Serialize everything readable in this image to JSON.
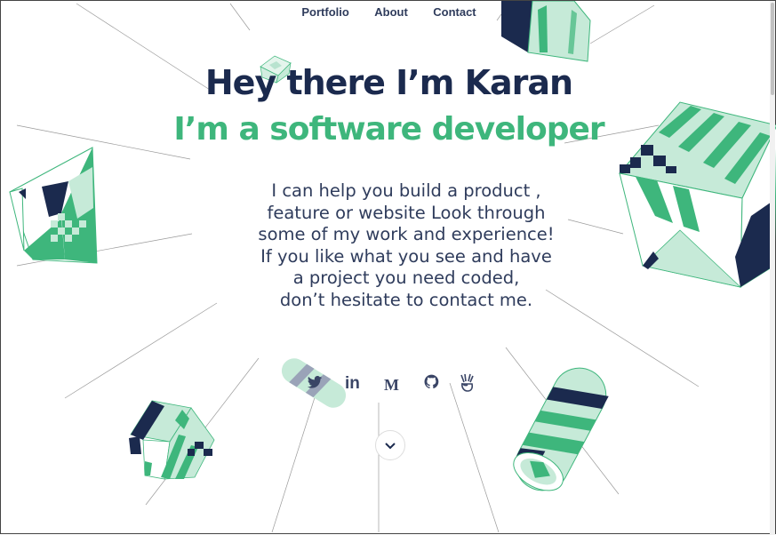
{
  "nav": {
    "items": [
      "Portfolio",
      "About",
      "Contact"
    ]
  },
  "hero": {
    "title": "Hey there I’m Karan",
    "subtitle": "I’m a software developer",
    "intro_lines": [
      "I can help you build a product ,",
      "feature or website Look through",
      "some of my work and experience!",
      "If you like what you see and have",
      "a project you need coded,",
      "don’t hesitate to contact me."
    ]
  },
  "socials": {
    "icons": [
      "twitter-icon",
      "linkedin-icon",
      "medium-icon",
      "github-icon",
      "angellist-icon"
    ],
    "linkedin_glyph": "in",
    "medium_glyph": "M"
  },
  "colors": {
    "navy": "#1b2a4e",
    "green": "#3eb67c",
    "mint": "#c6ead8",
    "text": "#2f3c5c"
  }
}
